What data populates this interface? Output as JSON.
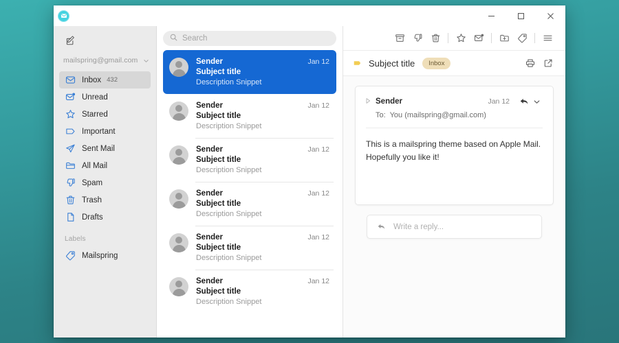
{
  "app": {
    "icon": "mailspring-envelope-icon",
    "window_controls": {
      "minimize": "minimize-icon",
      "maximize": "maximize-icon",
      "close": "close-icon"
    }
  },
  "sidebar": {
    "compose_icon": "compose-pencil-icon",
    "account": {
      "email": "mailspring@gmail.com",
      "caret": "chevron-down-icon"
    },
    "items": [
      {
        "label": "Inbox",
        "icon": "inbox-icon",
        "count": "432",
        "active": true
      },
      {
        "label": "Unread",
        "icon": "unread-icon",
        "count": "",
        "active": false
      },
      {
        "label": "Starred",
        "icon": "star-icon",
        "count": "",
        "active": false
      },
      {
        "label": "Important",
        "icon": "important-icon",
        "count": "",
        "active": false
      },
      {
        "label": "Sent Mail",
        "icon": "send-icon",
        "count": "",
        "active": false
      },
      {
        "label": "All Mail",
        "icon": "folder-icon",
        "count": "",
        "active": false
      },
      {
        "label": "Spam",
        "icon": "thumbs-down-icon",
        "count": "",
        "active": false
      },
      {
        "label": "Trash",
        "icon": "trash-icon",
        "count": "",
        "active": false
      },
      {
        "label": "Drafts",
        "icon": "draft-file-icon",
        "count": "",
        "active": false
      }
    ],
    "labels_header": "Labels",
    "labels": [
      {
        "label": "Mailspring",
        "icon": "tag-icon"
      }
    ]
  },
  "list": {
    "search": {
      "placeholder": "Search",
      "value": "",
      "icon": "search-icon"
    },
    "messages": [
      {
        "sender": "Sender",
        "subject": "Subject title",
        "snippet": "Description Snippet",
        "date": "Jan 12",
        "selected": true
      },
      {
        "sender": "Sender",
        "subject": "Subject title",
        "snippet": "Description Snippet",
        "date": "Jan 12",
        "selected": false
      },
      {
        "sender": "Sender",
        "subject": "Subject title",
        "snippet": "Description Snippet",
        "date": "Jan 12",
        "selected": false
      },
      {
        "sender": "Sender",
        "subject": "Subject title",
        "snippet": "Description Snippet",
        "date": "Jan 12",
        "selected": false
      },
      {
        "sender": "Sender",
        "subject": "Subject title",
        "snippet": "Description Snippet",
        "date": "Jan 12",
        "selected": false
      },
      {
        "sender": "Sender",
        "subject": "Subject title",
        "snippet": "Description Snippet",
        "date": "Jan 12",
        "selected": false
      }
    ]
  },
  "reading": {
    "toolbar": [
      {
        "name": "archive-icon",
        "label": "Archive"
      },
      {
        "name": "thumbs-down-icon",
        "label": "Mark as Spam"
      },
      {
        "name": "trash-icon",
        "label": "Trash"
      },
      {
        "name": "star-icon",
        "label": "Star"
      },
      {
        "name": "mark-unread-icon",
        "label": "Mark as Unread"
      },
      {
        "name": "move-to-folder-icon",
        "label": "Move to Folder"
      },
      {
        "name": "tag-icon",
        "label": "Apply Label"
      },
      {
        "name": "hamburger-menu-icon",
        "label": "More"
      }
    ],
    "subject": {
      "folder_icon": "folder-flag-icon",
      "title": "Subject title",
      "badge": "Inbox",
      "print_icon": "print-icon",
      "popout_icon": "open-external-icon"
    },
    "message": {
      "collapse_icon": "collapse-triangle-icon",
      "from": "Sender",
      "date": "Jan 12",
      "reply_icon": "reply-arrow-icon",
      "more_icon": "chevron-down-icon",
      "to_label": "To:",
      "to_value": "You (mailspring@gmail.com)",
      "body_line_1": "This is a mailspring theme based on Apple Mail.",
      "body_line_2": "Hopefully you like it!"
    },
    "reply": {
      "icon": "reply-arrow-icon",
      "placeholder": "Write a reply..."
    }
  },
  "colors": {
    "accent_blue": "#1568d3",
    "icon_blue": "#3a7fd5",
    "badge_bg": "#efdeb8",
    "folder_yellow": "#f2cd54",
    "desktop_teal_top": "#3cb0b0",
    "desktop_teal_bottom": "#29757a",
    "app_icon_teal": "#45d2e0"
  }
}
